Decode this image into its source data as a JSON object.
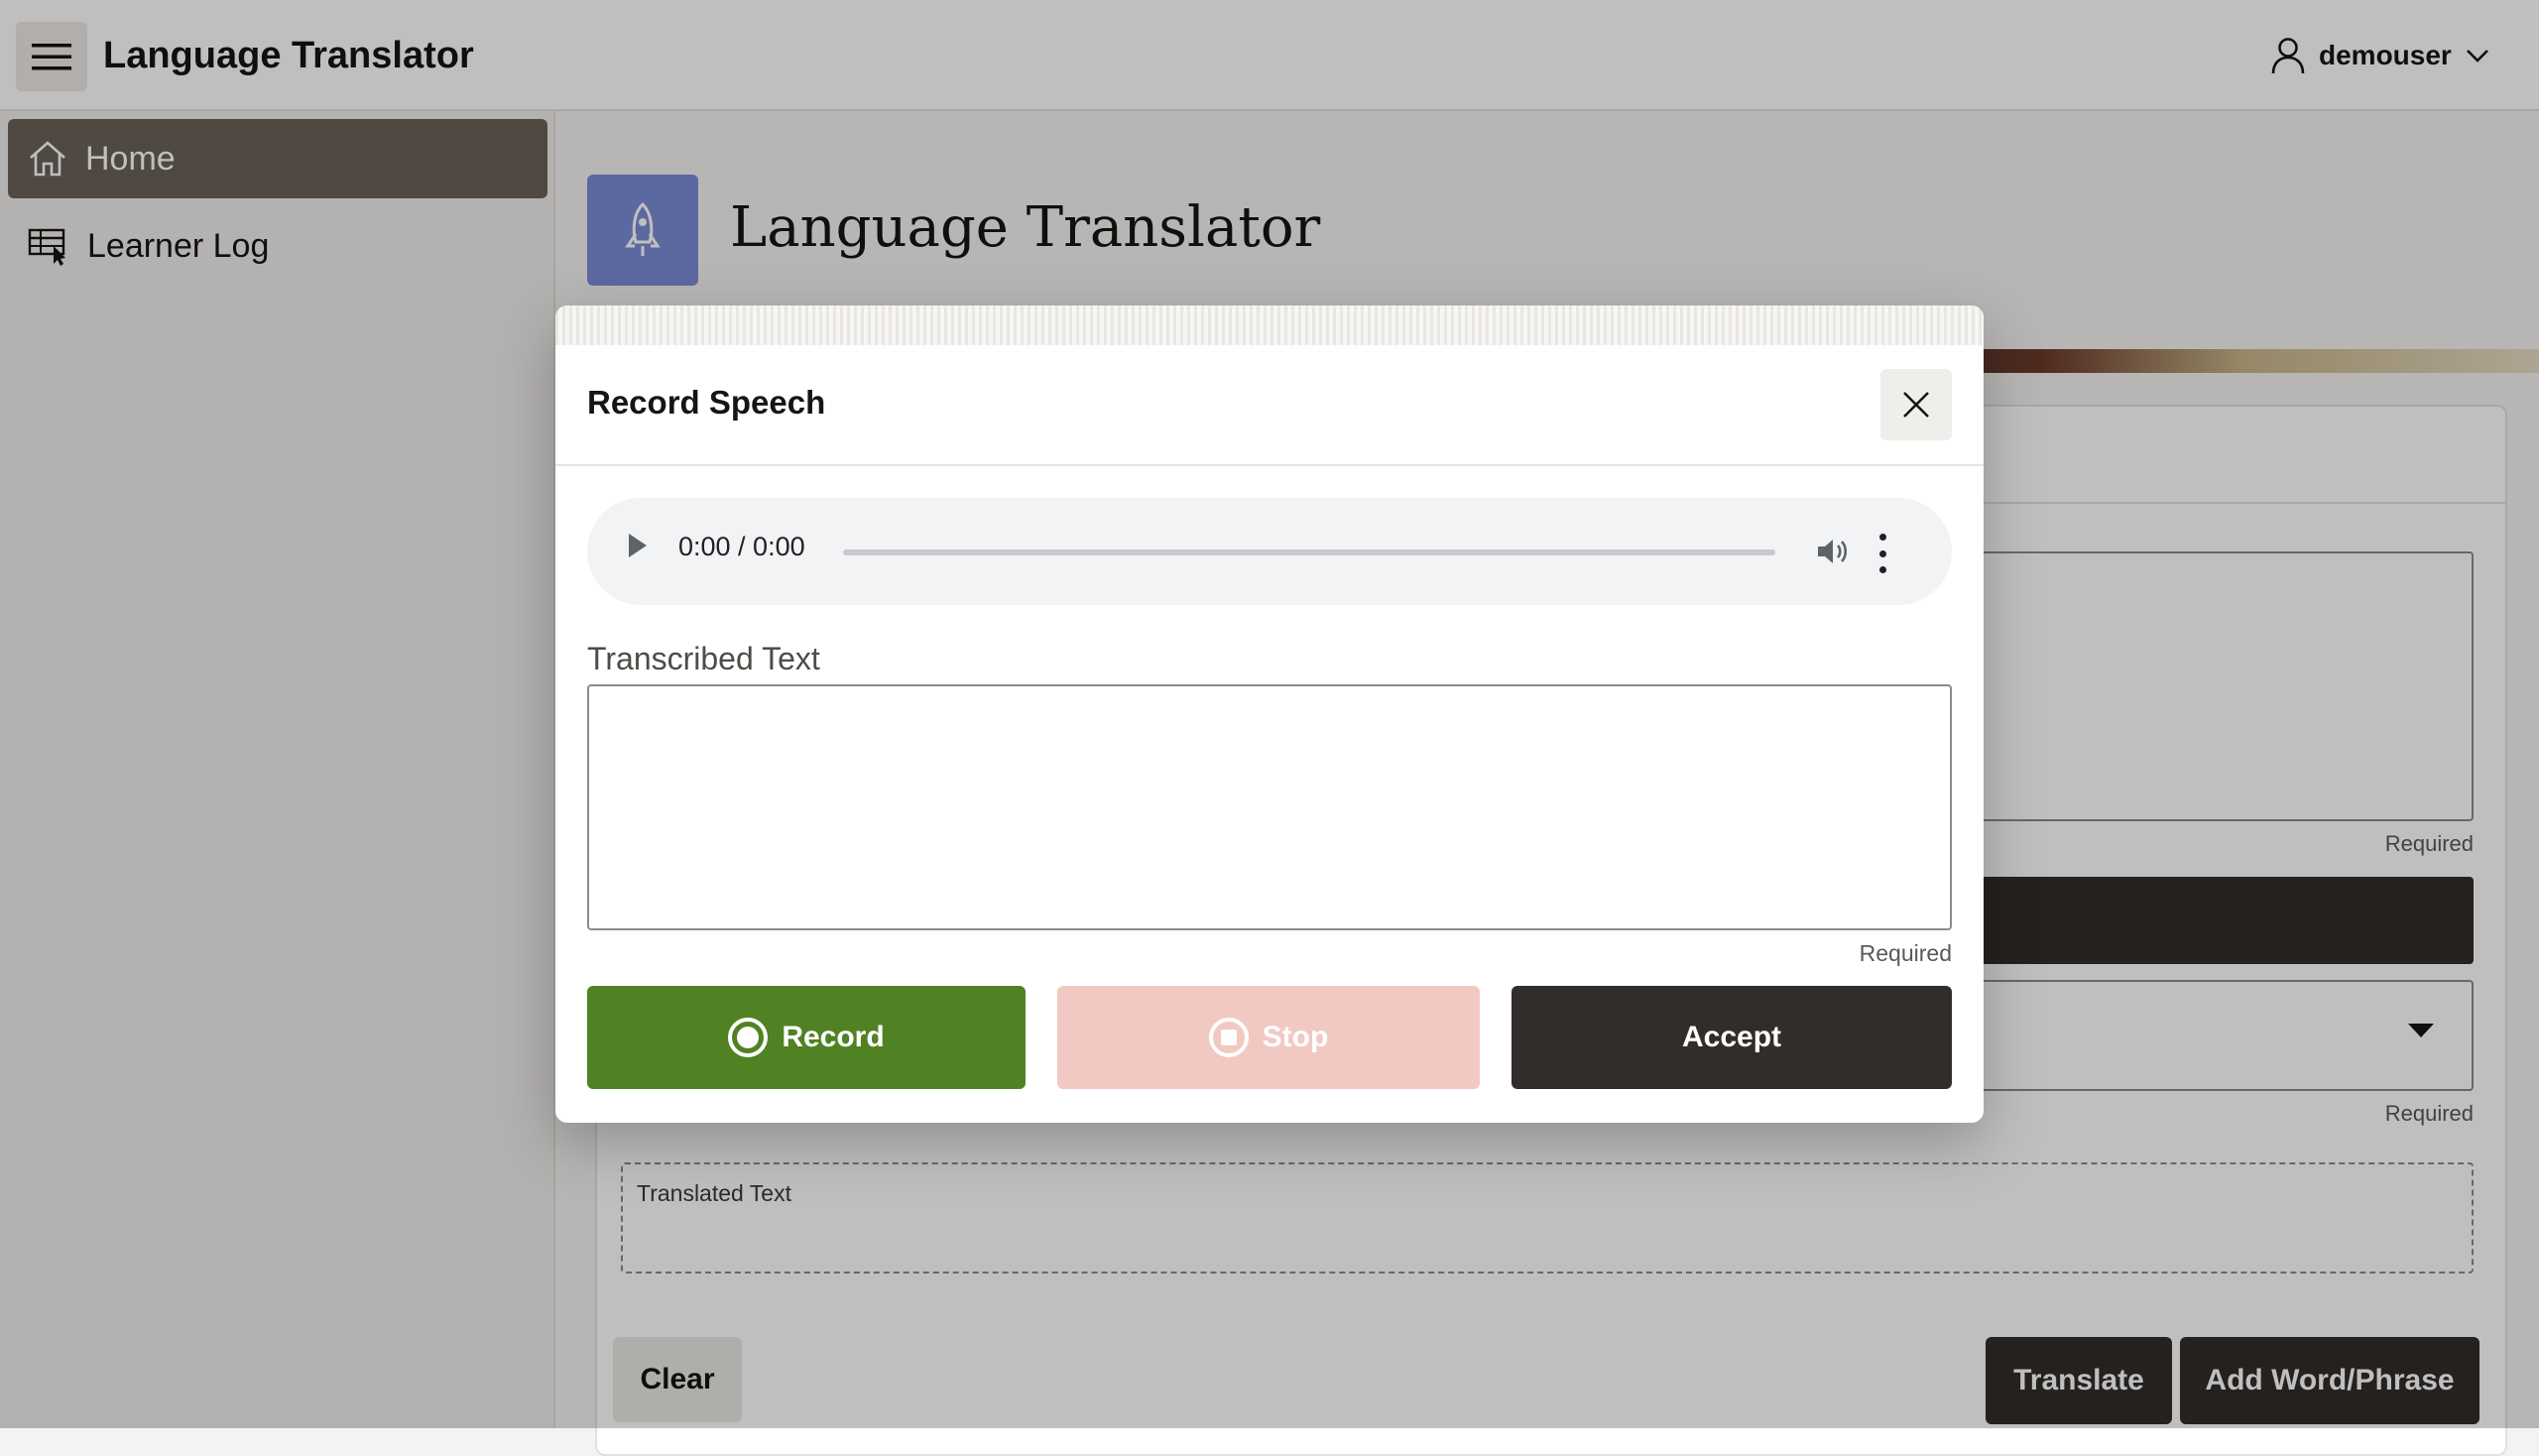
{
  "header": {
    "app_title": "Language Translator",
    "user_name": "demouser"
  },
  "sidebar": {
    "items": [
      {
        "label": "Home",
        "icon": "home-icon",
        "active": true
      },
      {
        "label": "Learner Log",
        "icon": "table-cursor-icon",
        "active": false
      }
    ]
  },
  "page": {
    "title": "Language Translator",
    "icon": "rocket-icon",
    "required_text_1": "Required",
    "required_text_2": "Required",
    "translated_label": "Translated Text",
    "clear_label": "Clear",
    "translate_label": "Translate",
    "add_word_label": "Add Word/Phrase"
  },
  "dialog": {
    "title": "Record Speech",
    "audio_time": "0:00 / 0:00",
    "transcribed_label": "Transcribed Text",
    "transcribed_value": "",
    "required_text": "Required",
    "record_label": "Record",
    "stop_label": "Stop",
    "accept_label": "Accept"
  },
  "colors": {
    "record_button": "#508223",
    "stop_button_disabled": "#f2c8c3",
    "accept_button": "#312d2a",
    "nav_active": "#6a6258",
    "page_icon_bg": "#7b8dd6"
  }
}
